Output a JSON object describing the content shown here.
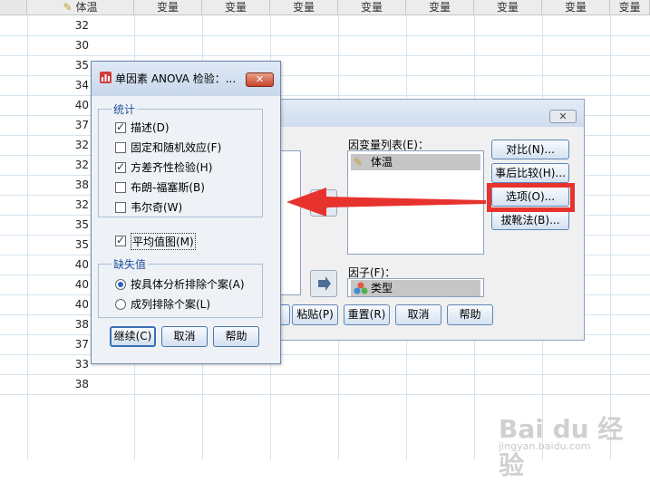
{
  "sheet": {
    "headers": [
      "体温",
      "变量",
      "变量",
      "变量",
      "变量",
      "变量",
      "变量",
      "变量",
      "变量",
      "变量"
    ],
    "rows": [
      "32",
      "30",
      "35",
      "34",
      "40",
      "37",
      "32",
      "32",
      "38",
      "32",
      "35",
      "35",
      "40",
      "40",
      "40",
      "38",
      "37",
      "33",
      "38"
    ]
  },
  "back_dialog": {
    "close_glyph": "✕",
    "dependent_label": "因变量列表(E)：",
    "dependent_items": [
      "体温"
    ],
    "factor_label": "因子(F)：",
    "factor_value": "类型",
    "side_buttons": [
      "对比(N)...",
      "事后比较(H)...",
      "选项(O)...",
      "拔靴法(B)..."
    ],
    "bottom_buttons": [
      "粘贴(P)",
      "重置(R)",
      "取消",
      "帮助"
    ]
  },
  "options_dialog": {
    "title": "单因素 ANOVA 检验：...",
    "close_glyph": "✕",
    "stats_group": "统计",
    "stats": [
      {
        "label": "描述(D)",
        "checked": true
      },
      {
        "label": "固定和随机效应(F)",
        "checked": false
      },
      {
        "label": "方差齐性检验(H)",
        "checked": true
      },
      {
        "label": "布朗-福塞斯(B)",
        "checked": false
      },
      {
        "label": "韦尔奇(W)",
        "checked": false
      }
    ],
    "means_plot": {
      "label": "平均值图(M)",
      "checked": true
    },
    "missing_group": "缺失值",
    "missing": [
      {
        "label": "按具体分析排除个案(A)",
        "checked": true
      },
      {
        "label": "成列排除个案(L)",
        "checked": false
      }
    ],
    "buttons": [
      "继续(C)",
      "取消",
      "帮助"
    ]
  },
  "watermark": {
    "text": "Bai du 经验",
    "url": "jingyan.baidu.com"
  },
  "colors": {
    "highlight": "#e8322e",
    "arrow": "#e8322e",
    "title_bar": "#c8d7eb"
  }
}
